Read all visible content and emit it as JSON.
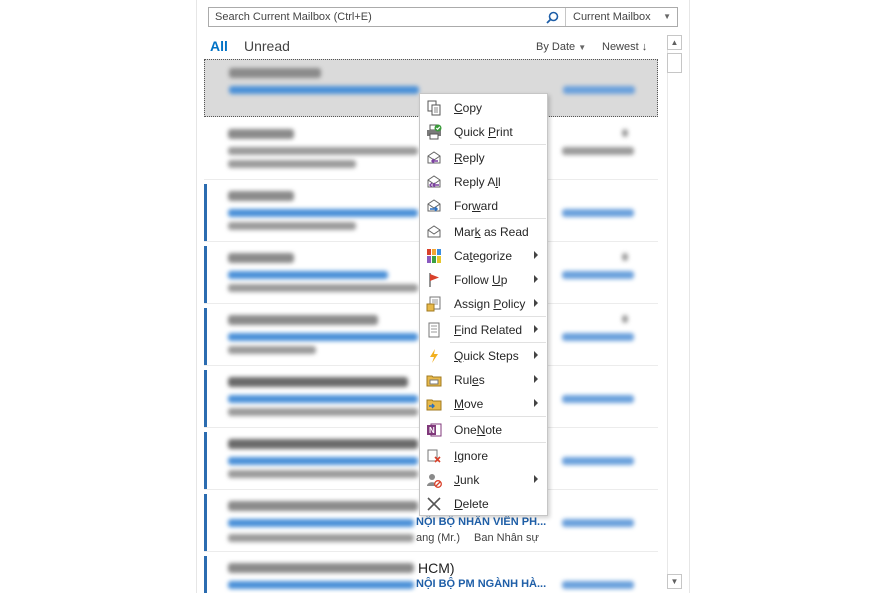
{
  "search": {
    "placeholder": "Search Current Mailbox (Ctrl+E)",
    "scope": "Current Mailbox"
  },
  "filters": {
    "all": "All",
    "unread": "Unread"
  },
  "sort": {
    "by": "By Date",
    "order": "Newest"
  },
  "messages": {
    "visible_fragments": {
      "subject_8": "NỘI BỘ NHÂN VIÊN PH...",
      "sender_8": "ang (Mr.)",
      "preview_8": "Ban Nhân sự",
      "sender_9": "HCM)",
      "subject_9": "NỘI BỘ PM NGÀNH HÀ..."
    }
  },
  "context_menu": {
    "items": [
      {
        "key": "copy",
        "pre": "",
        "u": "C",
        "post": "opy",
        "icon": "copy-icon",
        "submenu": false
      },
      {
        "key": "quick_print",
        "pre": "Quick ",
        "u": "P",
        "post": "rint",
        "icon": "quick-print-icon",
        "submenu": false
      },
      {
        "key": "reply",
        "pre": "",
        "u": "R",
        "post": "eply",
        "icon": "reply-icon",
        "submenu": false
      },
      {
        "key": "reply_all",
        "pre": "Reply A",
        "u": "l",
        "post": "l",
        "icon": "reply-all-icon",
        "submenu": false
      },
      {
        "key": "forward",
        "pre": "For",
        "u": "w",
        "post": "ard",
        "icon": "forward-icon",
        "submenu": false
      },
      {
        "key": "mark_read",
        "pre": "Mar",
        "u": "k",
        "post": " as Read",
        "icon": "mark-read-icon",
        "submenu": false
      },
      {
        "key": "categorize",
        "pre": "Ca",
        "u": "t",
        "post": "egorize",
        "icon": "categorize-icon",
        "submenu": true
      },
      {
        "key": "follow_up",
        "pre": "Follow ",
        "u": "U",
        "post": "p",
        "icon": "flag-icon",
        "submenu": true
      },
      {
        "key": "assign_policy",
        "pre": "Assign ",
        "u": "P",
        "post": "olicy",
        "icon": "assign-policy-icon",
        "submenu": true
      },
      {
        "key": "find_related",
        "pre": "",
        "u": "F",
        "post": "ind Related",
        "icon": "find-related-icon",
        "submenu": true
      },
      {
        "key": "quick_steps",
        "pre": "",
        "u": "Q",
        "post": "uick Steps",
        "icon": "lightning-icon",
        "submenu": true
      },
      {
        "key": "rules",
        "pre": "Rul",
        "u": "e",
        "post": "s",
        "icon": "rules-icon",
        "submenu": true
      },
      {
        "key": "move",
        "pre": "",
        "u": "M",
        "post": "ove",
        "icon": "move-folder-icon",
        "submenu": true
      },
      {
        "key": "onenote",
        "pre": "One",
        "u": "N",
        "post": "ote",
        "icon": "onenote-icon",
        "submenu": false
      },
      {
        "key": "ignore",
        "pre": "",
        "u": "I",
        "post": "gnore",
        "icon": "ignore-icon",
        "submenu": false
      },
      {
        "key": "junk",
        "pre": "",
        "u": "J",
        "post": "unk",
        "icon": "junk-icon",
        "submenu": true
      },
      {
        "key": "delete",
        "pre": "",
        "u": "D",
        "post": "elete",
        "icon": "delete-icon",
        "submenu": false
      }
    ]
  },
  "colors": {
    "accent": "#0072c6",
    "unread_bar": "#2b6cb0",
    "selected_bg": "#dadada"
  }
}
